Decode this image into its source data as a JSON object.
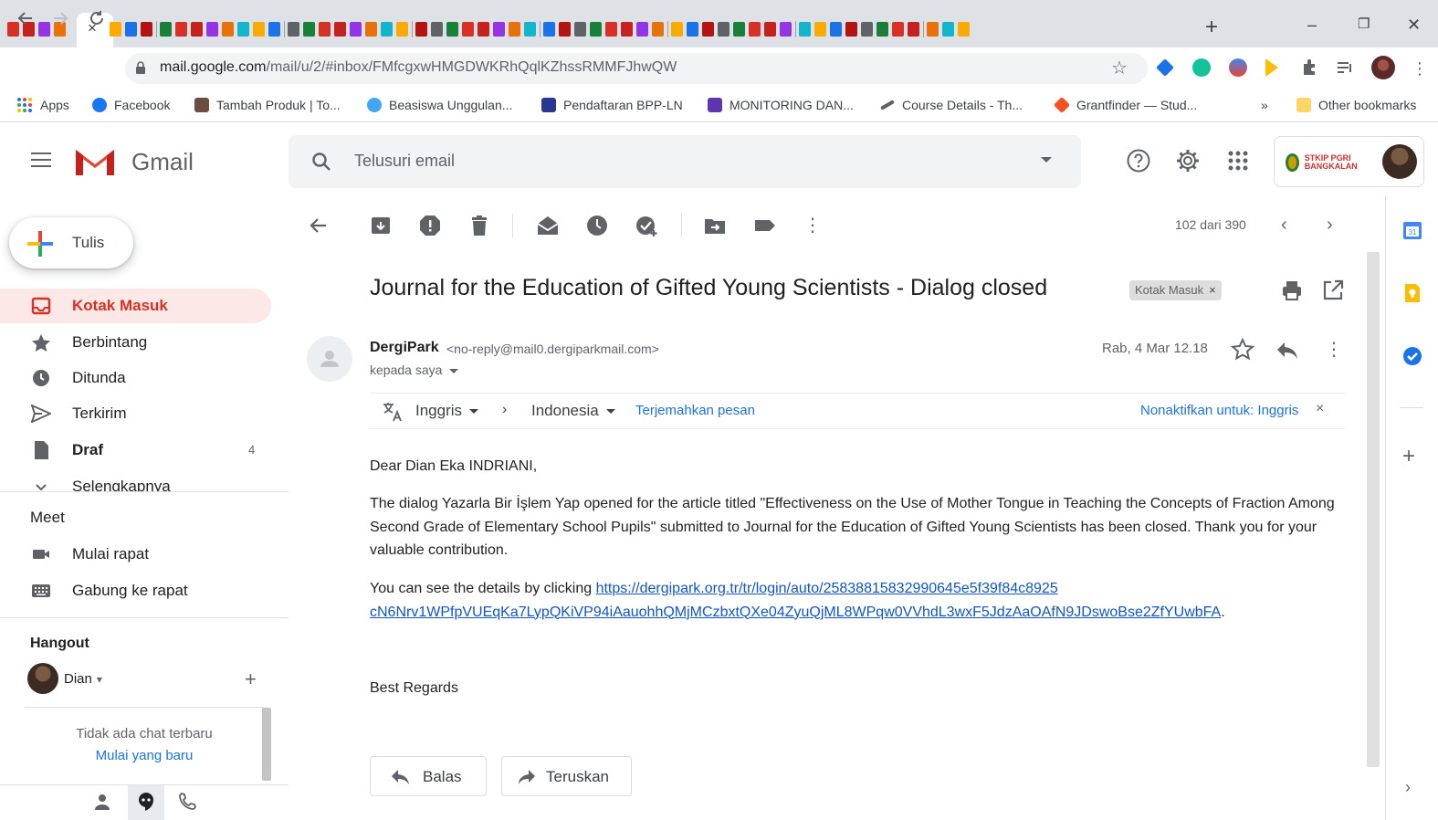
{
  "browser": {
    "tab_close": "×",
    "new_tab": "+",
    "url_host": "mail.google.com",
    "url_rest": "/mail/u/2/#inbox/FMfcgxwHMGDWKRhQqlKZhssRMMFJhwQW",
    "window_minimize": "–",
    "window_restore": "❐",
    "window_close": "✕"
  },
  "bookmarks": {
    "apps": "Apps",
    "items": [
      "Facebook",
      "Tambah Produk | To...",
      "Beasiswa Unggulan...",
      "Pendaftaran BPP-LN",
      "MONITORING DAN...",
      "Course Details - Th...",
      "Grantfinder — Stud..."
    ],
    "more": "»",
    "other": "Other bookmarks"
  },
  "gmail": {
    "product_name": "Gmail",
    "search_placeholder": "Telusuri email",
    "org_name": "STKIP PGRI BANGKALAN"
  },
  "nav": {
    "compose": "Tulis",
    "items": [
      {
        "label": "Kotak Masuk",
        "count": ""
      },
      {
        "label": "Berbintang",
        "count": ""
      },
      {
        "label": "Ditunda",
        "count": ""
      },
      {
        "label": "Terkirim",
        "count": ""
      },
      {
        "label": "Draf",
        "count": "4"
      },
      {
        "label": "Selengkapnya",
        "count": ""
      }
    ],
    "meet_title": "Meet",
    "meet_items": [
      "Mulai rapat",
      "Gabung ke rapat"
    ],
    "hangout_title": "Hangout",
    "hangout_user": "Dian",
    "no_chat": "Tidak ada chat terbaru",
    "start_new": "Mulai yang baru"
  },
  "message_toolbar": {
    "pager": "102 dari 390"
  },
  "message": {
    "subject": "Journal for the Education of Gifted Young Scientists - Dialog closed",
    "label": "Kotak Masuk",
    "label_remove": "×",
    "sender_name": "DergiPark",
    "sender_email": "<no-reply@mail0.dergiparkmail.com>",
    "to": "kepada saya",
    "date": "Rab, 4 Mar 12.18",
    "translate_from": "Inggris",
    "translate_to": "Indonesia",
    "translate_link": "Terjemahkan pesan",
    "disable_translate": "Nonaktifkan untuk: Inggris",
    "disable_x": "×",
    "greeting": "Dear Dian Eka INDRIANI,",
    "paragraph": "The dialog Yazarla Bir İşlem Yap opened for the article titled \"Effectiveness on the Use of Mother Tongue in Teaching the Concepts of Fraction Among Second Grade of Elementary School Pupils\" submitted to Journal for the Education of Gifted Young Scientists has been closed. Thank you for your valuable contribution.",
    "details_prefix": "You can see the details by clicking ",
    "details_link_1": "https://dergipark.org.tr/tr/login/auto/25838815832990645e5f39f84c8925",
    "details_link_2": "cN6Nrv1WPfpVUEqKa7LypQKiVP94iAauohhQMjMCzbxtQXe04ZyuQjML8WPqw0VVhdL3wxF5JdzAaOAfN9JDswoBse2ZfYUwbFA",
    "details_suffix": ".",
    "closing": "Best Regards",
    "reply": "Balas",
    "forward": "Teruskan"
  },
  "colors": {
    "gmail_red": "#d93025",
    "link_blue": "#1155cc",
    "accent_blue": "#1a73e8"
  },
  "icons": [
    "search-icon",
    "help-icon",
    "settings-gear-icon",
    "apps-grid-icon",
    "back-arrow-icon",
    "archive-icon",
    "report-spam-icon",
    "delete-icon",
    "mark-unread-icon",
    "snooze-icon",
    "add-task-icon",
    "move-to-icon",
    "label-icon",
    "more-vert-icon",
    "print-icon",
    "open-new-window-icon",
    "star-icon",
    "reply-icon",
    "translate-icon",
    "calendar-icon",
    "keep-icon",
    "tasks-icon"
  ]
}
